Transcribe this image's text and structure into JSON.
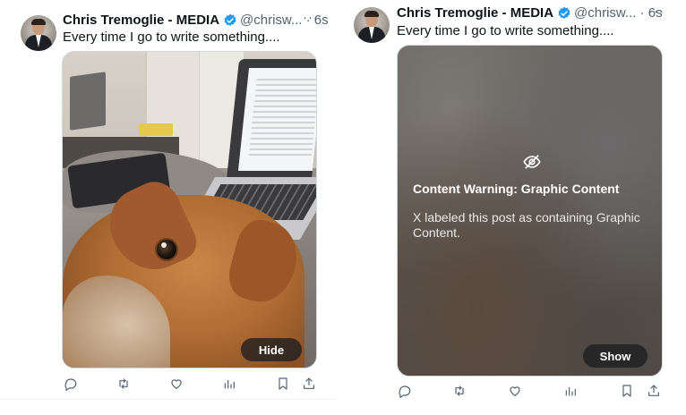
{
  "tweets": [
    {
      "author_name": "Chris Tremoglie - MEDIA",
      "handle_time": "@chrisw... · 6s",
      "more": "···",
      "text": "Every time I go to write something....",
      "media_button": "Hide"
    },
    {
      "author_name": "Chris Tremoglie - MEDIA",
      "handle_time": "@chrisw... · 6s",
      "more": "···",
      "text": "Every time I go to write something....",
      "warning_title": "Content Warning: Graphic Content",
      "warning_body": "X labeled this post as containing Graphic Content.",
      "media_button": "Show"
    }
  ],
  "action_icons": [
    "reply-icon",
    "repost-icon",
    "like-icon",
    "views-icon",
    "bookmark-icon",
    "share-icon"
  ],
  "colors": {
    "verified": "#1d9bf0",
    "icon": "#536471",
    "text": "#0f1419"
  }
}
